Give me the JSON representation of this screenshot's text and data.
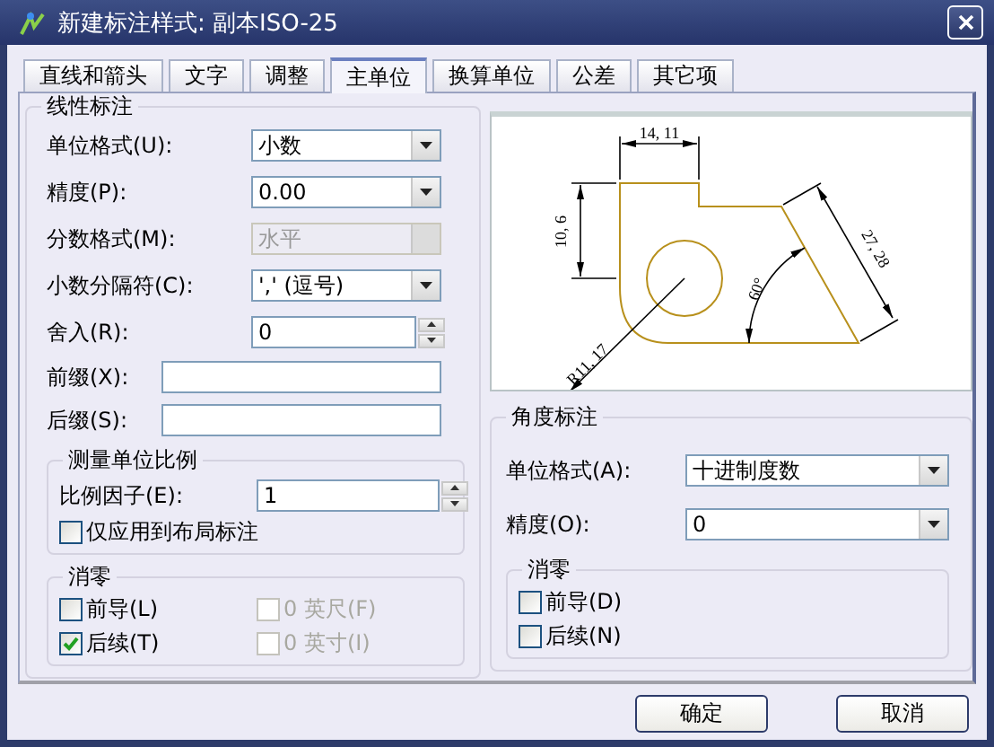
{
  "window": {
    "title": "新建标注样式: 副本ISO-25"
  },
  "tabs": [
    {
      "label": "直线和箭头",
      "selected": false
    },
    {
      "label": "文字",
      "selected": false
    },
    {
      "label": "调整",
      "selected": false
    },
    {
      "label": "主单位",
      "selected": true
    },
    {
      "label": "换算单位",
      "selected": false
    },
    {
      "label": "公差",
      "selected": false
    },
    {
      "label": "其它项",
      "selected": false
    }
  ],
  "linear": {
    "title": "线性标注",
    "fields": [
      {
        "kind": "combo",
        "label": "单位格式(U):",
        "value": "小数",
        "disabled": false
      },
      {
        "kind": "combo",
        "label": "精度(P):",
        "value": "0.00",
        "disabled": false
      },
      {
        "kind": "combo",
        "label": "分数格式(M):",
        "value": "水平",
        "disabled": true
      },
      {
        "kind": "combo",
        "label": "小数分隔符(C):",
        "value": "',' (逗号)",
        "disabled": false
      },
      {
        "kind": "spin",
        "label": "舍入(R):",
        "value": "0",
        "disabled": false
      },
      {
        "kind": "text",
        "label": "前缀(X):",
        "disabled": false
      },
      {
        "kind": "text",
        "label": "后缀(S):",
        "disabled": false
      }
    ],
    "scale": {
      "title": "测量单位比例",
      "fields": [
        {
          "kind": "spin",
          "label": "比例因子(E):",
          "value": "1",
          "disabled": false
        }
      ],
      "check": {
        "label": "仅应用到布局标注",
        "checked": false,
        "disabled": false
      }
    },
    "zero": {
      "title": "消零",
      "checks": [
        {
          "label": "前导(L)",
          "checked": false,
          "disabled": false
        },
        {
          "label": "0 英尺(F)",
          "checked": false,
          "disabled": true
        },
        {
          "label": "后续(T)",
          "checked": true,
          "disabled": false
        },
        {
          "label": "0 英寸(I)",
          "checked": false,
          "disabled": true
        }
      ]
    }
  },
  "preview": {
    "labels": [
      "14, 11",
      "10, 6",
      "27, 28",
      "60°",
      "R11, 17"
    ]
  },
  "angular": {
    "title": "角度标注",
    "fields": [
      {
        "kind": "combo",
        "label": "单位格式(A):",
        "value": "十进制度数",
        "disabled": false
      },
      {
        "kind": "combo",
        "label": "精度(O):",
        "value": "0",
        "disabled": false
      }
    ],
    "zero": {
      "title": "消零",
      "checks": [
        {
          "label": "前导(D)",
          "checked": false,
          "disabled": false
        },
        {
          "label": "后续(N)",
          "checked": false,
          "disabled": false
        }
      ]
    }
  },
  "buttons": [
    "确定",
    "取消"
  ]
}
